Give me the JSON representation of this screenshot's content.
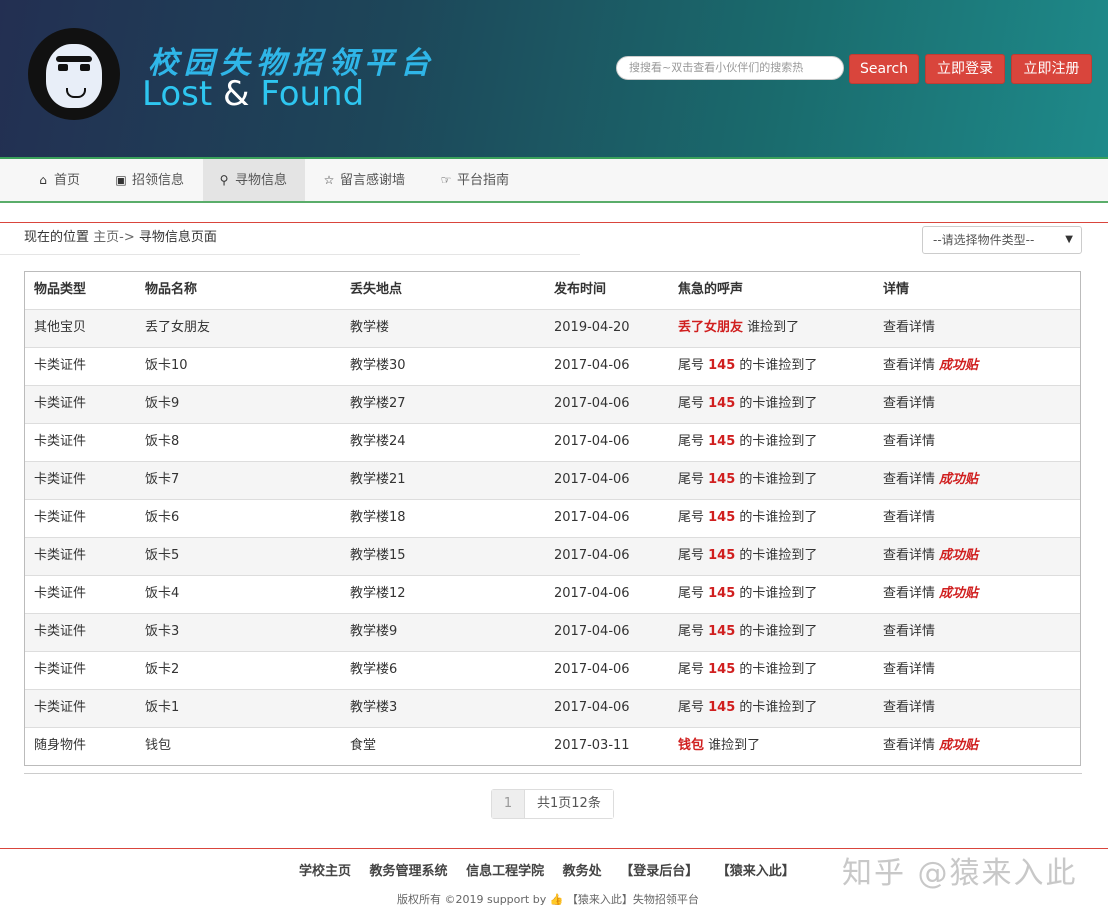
{
  "header": {
    "title_cn": "校园失物招领平台",
    "title_en_lost": "Lost",
    "title_en_amp": "&",
    "title_en_found": "Found",
    "search_placeholder": "搜搜看~双击查看小伙伴们的搜索热",
    "search_button": "Search",
    "login_button": "立即登录",
    "register_button": "立即注册"
  },
  "nav": {
    "items": [
      {
        "label": "首页",
        "icon": "home-icon"
      },
      {
        "label": "招领信息",
        "icon": "image-icon"
      },
      {
        "label": "寻物信息",
        "icon": "search-icon",
        "active": true
      },
      {
        "label": "留言感谢墙",
        "icon": "star-icon"
      },
      {
        "label": "平台指南",
        "icon": "hand-pointer-icon"
      }
    ]
  },
  "breadcrumb": {
    "prefix": "现在的位置",
    "home": "主页->",
    "current": "寻物信息页面"
  },
  "filter": {
    "type_select": "--请选择物件类型--"
  },
  "table": {
    "headers": [
      "物品类型",
      "物品名称",
      "丢失地点",
      "发布时间",
      "焦急的呼声",
      "详情"
    ],
    "rows": [
      {
        "type": "其他宝贝",
        "name": "丢了女朋友",
        "place": "教学楼",
        "date": "2019-04-20",
        "call_pre": "",
        "call_hl": "丢了女朋友",
        "call_post": " 谁捡到了",
        "detail": "查看详情",
        "success": ""
      },
      {
        "type": "卡类证件",
        "name": "饭卡10",
        "place": "教学楼30",
        "date": "2017-04-06",
        "call_pre": "尾号 ",
        "call_hl": "145",
        "call_post": " 的卡谁捡到了",
        "detail": "查看详情",
        "success": "成功贴"
      },
      {
        "type": "卡类证件",
        "name": "饭卡9",
        "place": "教学楼27",
        "date": "2017-04-06",
        "call_pre": "尾号 ",
        "call_hl": "145",
        "call_post": " 的卡谁捡到了",
        "detail": "查看详情",
        "success": ""
      },
      {
        "type": "卡类证件",
        "name": "饭卡8",
        "place": "教学楼24",
        "date": "2017-04-06",
        "call_pre": "尾号 ",
        "call_hl": "145",
        "call_post": " 的卡谁捡到了",
        "detail": "查看详情",
        "success": ""
      },
      {
        "type": "卡类证件",
        "name": "饭卡7",
        "place": "教学楼21",
        "date": "2017-04-06",
        "call_pre": "尾号 ",
        "call_hl": "145",
        "call_post": " 的卡谁捡到了",
        "detail": "查看详情",
        "success": "成功贴"
      },
      {
        "type": "卡类证件",
        "name": "饭卡6",
        "place": "教学楼18",
        "date": "2017-04-06",
        "call_pre": "尾号 ",
        "call_hl": "145",
        "call_post": " 的卡谁捡到了",
        "detail": "查看详情",
        "success": ""
      },
      {
        "type": "卡类证件",
        "name": "饭卡5",
        "place": "教学楼15",
        "date": "2017-04-06",
        "call_pre": "尾号 ",
        "call_hl": "145",
        "call_post": " 的卡谁捡到了",
        "detail": "查看详情",
        "success": "成功贴"
      },
      {
        "type": "卡类证件",
        "name": "饭卡4",
        "place": "教学楼12",
        "date": "2017-04-06",
        "call_pre": "尾号 ",
        "call_hl": "145",
        "call_post": " 的卡谁捡到了",
        "detail": "查看详情",
        "success": "成功贴"
      },
      {
        "type": "卡类证件",
        "name": "饭卡3",
        "place": "教学楼9",
        "date": "2017-04-06",
        "call_pre": "尾号 ",
        "call_hl": "145",
        "call_post": " 的卡谁捡到了",
        "detail": "查看详情",
        "success": ""
      },
      {
        "type": "卡类证件",
        "name": "饭卡2",
        "place": "教学楼6",
        "date": "2017-04-06",
        "call_pre": "尾号 ",
        "call_hl": "145",
        "call_post": " 的卡谁捡到了",
        "detail": "查看详情",
        "success": ""
      },
      {
        "type": "卡类证件",
        "name": "饭卡1",
        "place": "教学楼3",
        "date": "2017-04-06",
        "call_pre": "尾号 ",
        "call_hl": "145",
        "call_post": " 的卡谁捡到了",
        "detail": "查看详情",
        "success": ""
      },
      {
        "type": "随身物件",
        "name": "钱包",
        "place": "食堂",
        "date": "2017-03-11",
        "call_pre": "",
        "call_hl": "钱包",
        "call_post": " 谁捡到了",
        "detail": "查看详情",
        "success": "成功贴"
      }
    ]
  },
  "pagination": {
    "current_page": "1",
    "summary": "共1页12条"
  },
  "footer": {
    "links": [
      "学校主页",
      "教务管理系统",
      "信息工程学院",
      "教务处",
      "【登录后台】",
      "【猿来入此】"
    ],
    "copyright_pre": "版权所有 ©2019 support by",
    "copyright_post": "【猿来入此】失物招领平台",
    "watermark": "知乎 @猿来入此"
  },
  "colors": {
    "accent_red": "#d9453c",
    "highlight_red": "#d01f1f",
    "nav_green": "#3aa15a"
  }
}
